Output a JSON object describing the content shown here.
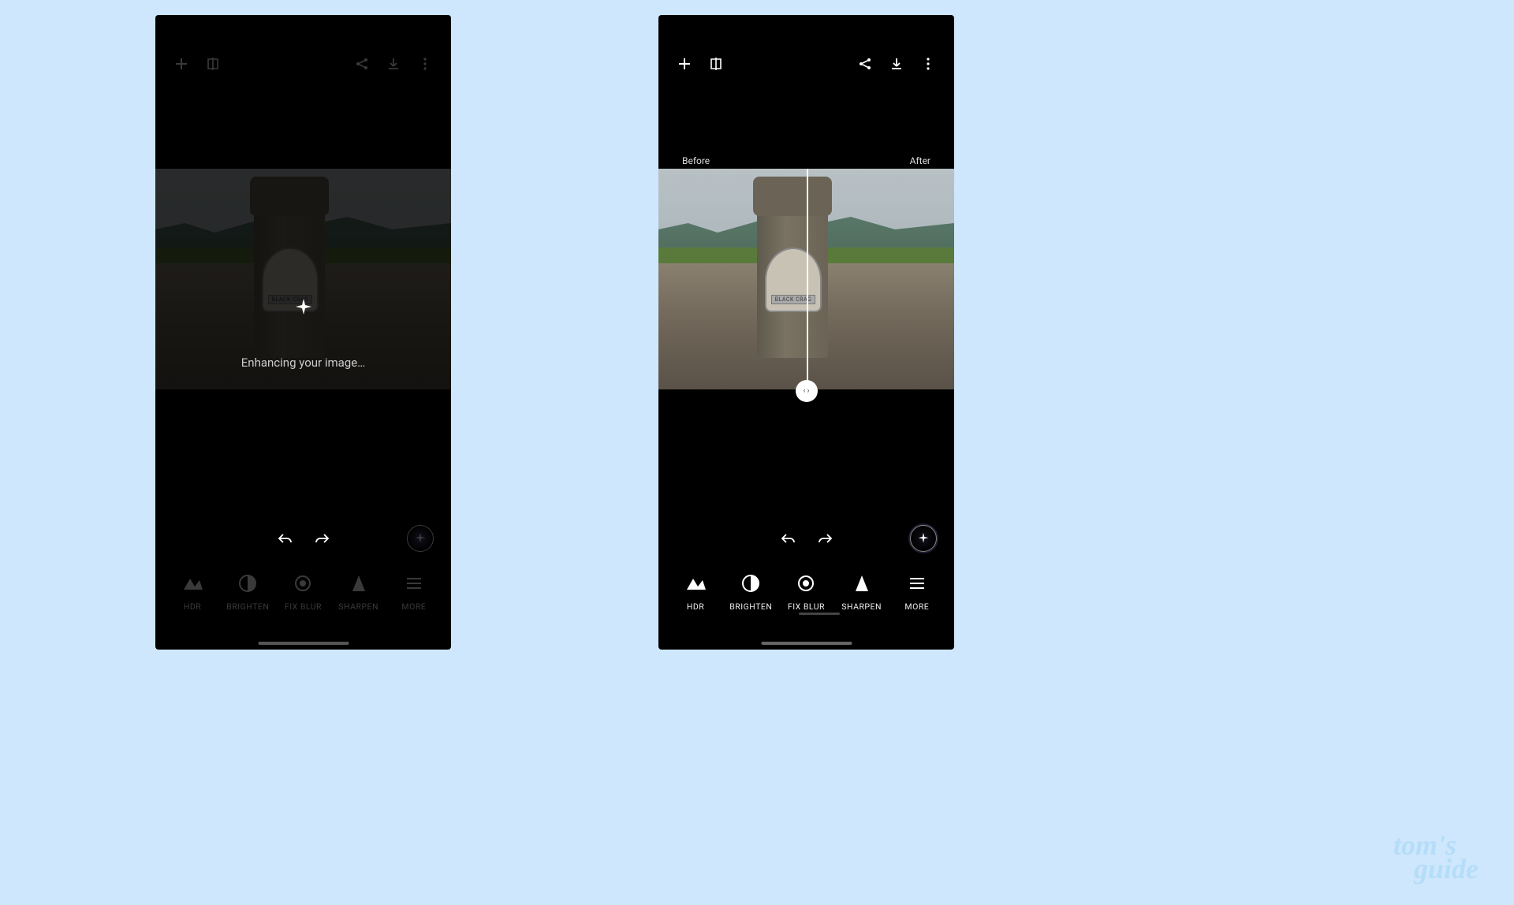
{
  "watermark": {
    "line1": "tom's",
    "line2": "guide"
  },
  "left_phone": {
    "loading_text": "Enhancing your image…",
    "plaque_text": "BLACK CRAG"
  },
  "right_phone": {
    "before_label": "Before",
    "after_label": "After",
    "slider_handle": "‹ ›",
    "plaque_text": "BLACK CRAG"
  },
  "tools": {
    "hdr": "HDR",
    "brighten": "BRIGHTEN",
    "fixblur": "FIX BLUR",
    "sharpen": "SHARPEN",
    "more": "MORE"
  }
}
